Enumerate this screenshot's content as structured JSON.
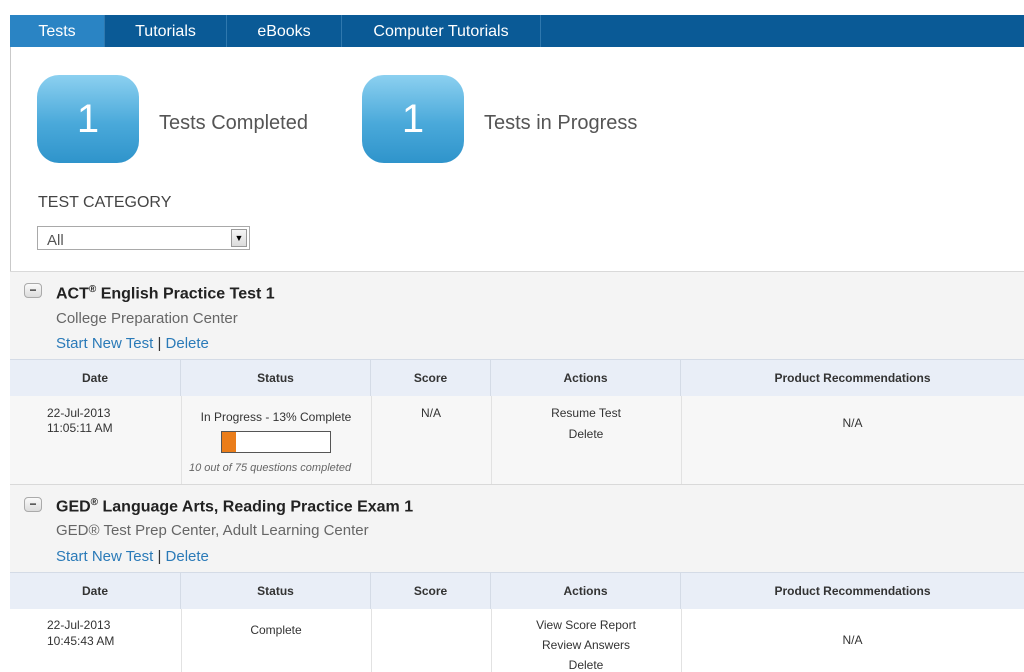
{
  "nav": {
    "tabs": [
      {
        "label": "Tests",
        "active": true
      },
      {
        "label": "Tutorials",
        "active": false
      },
      {
        "label": "eBooks",
        "active": false
      },
      {
        "label": "Computer Tutorials",
        "active": false
      }
    ]
  },
  "stats": {
    "completed": {
      "count": "1",
      "label": "Tests Completed"
    },
    "in_progress": {
      "count": "1",
      "label": "Tests in Progress"
    }
  },
  "filter": {
    "label": "TEST CATEGORY",
    "selected": "All"
  },
  "table_headers": {
    "date": "Date",
    "status": "Status",
    "score": "Score",
    "actions": "Actions",
    "recommendations": "Product Recommendations"
  },
  "tests": [
    {
      "title": "ACT",
      "title_mark": "®",
      "title_rest": " English Practice Test 1",
      "subtitle": "College Preparation Center",
      "start_link": "Start New Test",
      "separator": "|",
      "delete_link": "Delete",
      "row": {
        "date": "22-Jul-2013",
        "time": "11:05:11 AM",
        "status": "In Progress - 13% Complete",
        "progress": 0.13,
        "progress_note": "10 out of 75 questions completed",
        "score": "N/A",
        "actions": [
          "Resume Test",
          "Delete"
        ],
        "recommendations": "N/A"
      }
    },
    {
      "title": "GED",
      "title_mark": "®",
      "title_rest": " Language Arts, Reading Practice Exam 1",
      "subtitle": "GED® Test Prep Center, Adult Learning Center",
      "start_link": "Start New Test",
      "separator": "|",
      "delete_link": "Delete",
      "row": {
        "date": "22-Jul-2013",
        "time": "10:45:43 AM",
        "status": "Complete",
        "score": "",
        "actions": [
          "View Score Report",
          "Review Answers",
          "Delete"
        ],
        "recommendations": "N/A"
      }
    }
  ],
  "colors": {
    "nav_bg": "#0a5a96",
    "nav_active": "#2a84c4",
    "link": "#2a7ab8",
    "progress_fill": "#ea7d1a",
    "stat_box": "#4aa9da"
  }
}
